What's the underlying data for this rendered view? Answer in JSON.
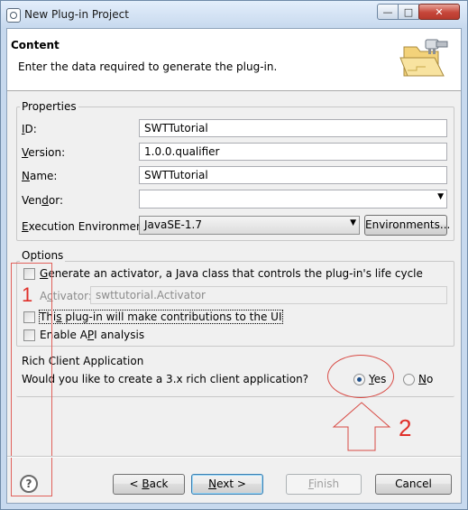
{
  "window": {
    "title": "New Plug-in Project",
    "controls": {
      "minimize": "—",
      "maximize": "□",
      "close": "✕"
    }
  },
  "header": {
    "title": "Content",
    "description": "Enter the data required to generate the plug-in."
  },
  "properties": {
    "group_label": "Properties",
    "id": {
      "label_first": "I",
      "label_rest": "D:",
      "value": "SWTTutorial"
    },
    "version": {
      "label_first": "V",
      "label_rest": "ersion:",
      "value": "1.0.0.qualifier"
    },
    "name": {
      "label_first": "N",
      "label_rest": "ame:",
      "value": "SWTTutorial"
    },
    "vendor": {
      "label_pre": "Ven",
      "label_ul": "d",
      "label_post": "or:",
      "value": ""
    },
    "execution_environment": {
      "label_ul": "E",
      "label_rest": "xecution Environment:",
      "value": "JavaSE-1.7",
      "button": "Environments..."
    }
  },
  "options": {
    "group_label": "Options",
    "generate_activator": {
      "label_ul": "G",
      "label_rest": "enerate an activator, a Java class that controls the plug-in's life cycle",
      "checked": false
    },
    "activator": {
      "label_pre": "A",
      "label_ul": "c",
      "label_post": "tivator:",
      "value": "swttutorial.Activator"
    },
    "ui_contributions": {
      "label_pre": "Thi",
      "label_ul": "s",
      "label_post": " plug-in will make contributions to the UI",
      "checked": false
    },
    "enable_api": {
      "label_pre": "Enable A",
      "label_ul": "P",
      "label_post": "I analysis",
      "checked": false
    }
  },
  "rcp": {
    "group_label": "Rich Client Application",
    "question": "Would you like to create a 3.x rich client application?",
    "yes": {
      "label_ul": "Y",
      "label_rest": "es",
      "selected": true
    },
    "no": {
      "label_ul": "N",
      "label_rest": "o",
      "selected": false
    }
  },
  "footer": {
    "help": "?",
    "back": {
      "pre": "< ",
      "ul": "B",
      "post": "ack"
    },
    "next": {
      "ul": "N",
      "post": "ext >"
    },
    "finish": {
      "ul": "F",
      "post": "inish"
    },
    "cancel": "Cancel"
  },
  "annotations": {
    "marker_1": "1",
    "marker_2": "2",
    "color": "#e0302a"
  }
}
